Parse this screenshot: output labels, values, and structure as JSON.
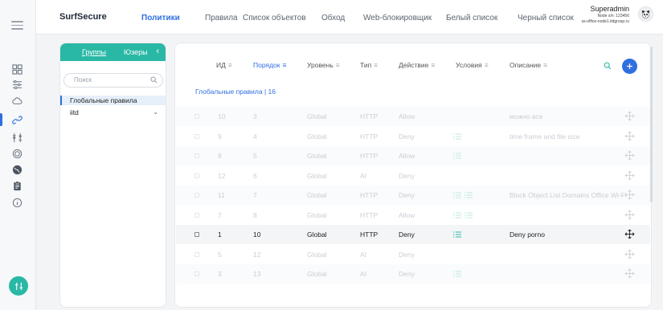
{
  "app": {
    "brand": "SurfSecure"
  },
  "nav": [
    {
      "label": "Политики",
      "active": true
    },
    {
      "label": "Правила",
      "active": false
    },
    {
      "label": "Список объектов",
      "active": false
    },
    {
      "label": "Обход",
      "active": false
    },
    {
      "label": "Web-блокировщик",
      "active": false
    },
    {
      "label": "Белый список",
      "active": false
    },
    {
      "label": "Черный список",
      "active": false
    }
  ],
  "user": {
    "name": "Superadmin",
    "node_line": "Node s/n: 123456",
    "host": "ss-office-node1.itdgroup.ru"
  },
  "groups_panel": {
    "tab_groups": "Группы",
    "tab_users": "Юзеры",
    "search_placeholder": "Поиск",
    "items": [
      {
        "label": "Глобальные правила",
        "selected": true
      },
      {
        "label": "iitd",
        "expandable": true
      }
    ]
  },
  "rules": {
    "headers": {
      "id": "ИД",
      "order": "Порядок",
      "level": "Уровень",
      "type": "Тип",
      "action": "Действие",
      "conditions": "Условия",
      "description": "Описание"
    },
    "group_title": "Глобальные правила | 16",
    "rows": [
      {
        "id": "10",
        "order": "3",
        "level": "Global",
        "type": "HTTP",
        "action": "Allow",
        "conditions": 0,
        "description": "можно все"
      },
      {
        "id": "9",
        "order": "4",
        "level": "Global",
        "type": "HTTP",
        "action": "Deny",
        "conditions": 1,
        "description": "time frame and file size"
      },
      {
        "id": "8",
        "order": "5",
        "level": "Global",
        "type": "HTTP",
        "action": "Allow",
        "conditions": 1,
        "description": ""
      },
      {
        "id": "12",
        "order": "6",
        "level": "Global",
        "type": "AI",
        "action": "Deny",
        "conditions": 0,
        "description": ""
      },
      {
        "id": "11",
        "order": "7",
        "level": "Global",
        "type": "HTTP",
        "action": "Deny",
        "conditions": 2,
        "description": "Block Object List Domains Office Wi-Fi"
      },
      {
        "id": "7",
        "order": "8",
        "level": "Global",
        "type": "HTTP",
        "action": "Allow",
        "conditions": 2,
        "description": ""
      },
      {
        "id": "1",
        "order": "10",
        "level": "Global",
        "type": "HTTP",
        "action": "Deny",
        "conditions": 1,
        "description": "Deny porno",
        "highlighted": true
      },
      {
        "id": "5",
        "order": "12",
        "level": "Global",
        "type": "AI",
        "action": "Deny",
        "conditions": 0,
        "description": ""
      },
      {
        "id": "3",
        "order": "13",
        "level": "Global",
        "type": "AI",
        "action": "Deny",
        "conditions": 1,
        "description": ""
      }
    ]
  },
  "colors": {
    "accent": "#2f6fe0",
    "teal": "#2ab8a6",
    "condition": "#2ab8a6"
  },
  "icons": [
    "menu-icon",
    "dashboard-icon",
    "sliders-icon",
    "cloud-icon",
    "link-icon",
    "filter-list-icon",
    "target-icon",
    "globe-icon",
    "clipboard-icon",
    "info-icon",
    "search-icon",
    "plus-icon",
    "move-icon",
    "panda-avatar-icon"
  ]
}
